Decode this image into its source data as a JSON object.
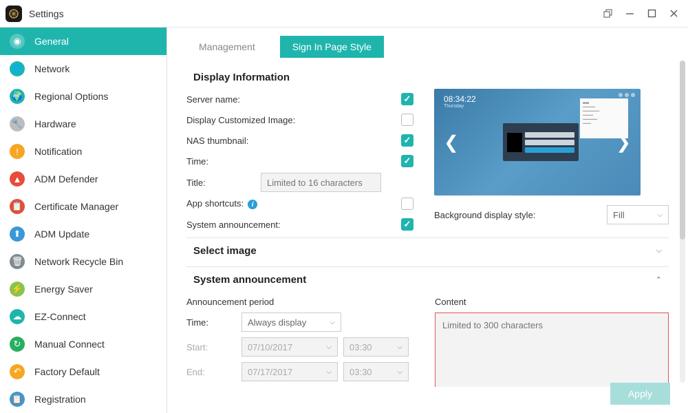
{
  "window": {
    "title": "Settings"
  },
  "sidebar": {
    "items": [
      {
        "label": "General",
        "icon_bg": "#1fb5ad",
        "active": true,
        "name": "sidebar-item-general"
      },
      {
        "label": "Network",
        "icon_bg": "#1fb5ad",
        "name": "sidebar-item-network"
      },
      {
        "label": "Regional Options",
        "icon_bg": "#1fb5ad",
        "name": "sidebar-item-regional"
      },
      {
        "label": "Hardware",
        "icon_bg": "#bdbdbd",
        "name": "sidebar-item-hardware"
      },
      {
        "label": "Notification",
        "icon_bg": "#f6a623",
        "name": "sidebar-item-notification"
      },
      {
        "label": "ADM Defender",
        "icon_bg": "#e74c3c",
        "name": "sidebar-item-adm-defender"
      },
      {
        "label": "Certificate Manager",
        "icon_bg": "#e74c3c",
        "name": "sidebar-item-certificate-manager"
      },
      {
        "label": "ADM Update",
        "icon_bg": "#3a99d8",
        "name": "sidebar-item-adm-update"
      },
      {
        "label": "Network Recycle Bin",
        "icon_bg": "#7f8c8d",
        "name": "sidebar-item-recycle-bin"
      },
      {
        "label": "Energy Saver",
        "icon_bg": "#8bc34a",
        "name": "sidebar-item-energy-saver"
      },
      {
        "label": "EZ-Connect",
        "icon_bg": "#1fb5ad",
        "name": "sidebar-item-ez-connect"
      },
      {
        "label": "Manual Connect",
        "icon_bg": "#27ae60",
        "name": "sidebar-item-manual-connect"
      },
      {
        "label": "Factory Default",
        "icon_bg": "#f6a623",
        "name": "sidebar-item-factory-default"
      },
      {
        "label": "Registration",
        "icon_bg": "#3a99d8",
        "name": "sidebar-item-registration"
      }
    ]
  },
  "tabs": {
    "management": "Management",
    "signin": "Sign In Page Style"
  },
  "display_info": {
    "heading": "Display Information",
    "server_name": "Server name:",
    "custom_image": "Display Customized Image:",
    "nas_thumb": "NAS thumbnail:",
    "time": "Time:",
    "title": "Title:",
    "title_placeholder": "Limited to 16 characters",
    "app_shortcuts": "App shortcuts:",
    "sys_announce": "System announcement:"
  },
  "preview": {
    "time": "08:34:22",
    "date": "Thursday",
    "bg_style_label": "Background display style:",
    "bg_style_value": "Fill"
  },
  "select_image": {
    "heading": "Select image"
  },
  "sys_announce": {
    "heading": "System announcement",
    "period_label": "Announcement period",
    "content_label": "Content",
    "time_label": "Time:",
    "time_value": "Always display",
    "start_label": "Start:",
    "start_date": "07/10/2017",
    "start_time": "03:30",
    "end_label": "End:",
    "end_date": "07/17/2017",
    "end_time": "03:30",
    "content_placeholder": "Limited to 300 characters"
  },
  "footer": {
    "apply": "Apply"
  }
}
